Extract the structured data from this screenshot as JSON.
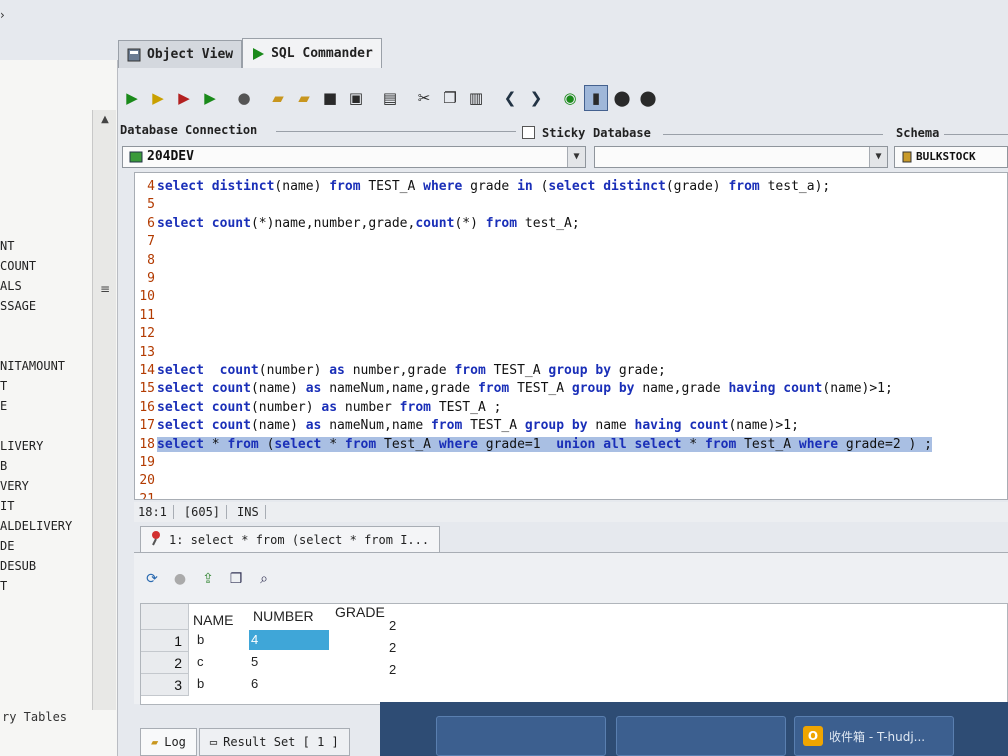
{
  "window": {
    "corner_glyph": "›"
  },
  "tabs": [
    {
      "label": "Object View",
      "active": false
    },
    {
      "label": "SQL Commander",
      "active": true
    }
  ],
  "connection": {
    "database_connection_label": "Database Connection",
    "database_connection_value": "204DEV",
    "sticky_label": "Sticky",
    "database_label": "Database",
    "database_value": "",
    "schema_label": "Schema",
    "schema_value": "BULKSTOCK"
  },
  "left_tree": {
    "items": [
      "NT",
      "COUNT",
      "ALS",
      "SSAGE",
      "",
      "",
      "NITAMOUNT",
      "T",
      "E",
      "",
      "LIVERY",
      "B",
      "VERY",
      "IT",
      "ALDELIVERY",
      "DE",
      "DESUB",
      "T"
    ],
    "bottom_label": "ry Tables"
  },
  "editor": {
    "lines": [
      {
        "n": "4",
        "text": "select distinct(name) from TEST_A where grade in (select distinct(grade) from test_a);",
        "highlight": false
      },
      {
        "n": "5",
        "text": "",
        "highlight": false
      },
      {
        "n": "6",
        "text": "select count(*)name,number,grade,count(*) from test_A;",
        "highlight": false
      },
      {
        "n": "7",
        "text": "",
        "highlight": false
      },
      {
        "n": "8",
        "text": "",
        "highlight": false
      },
      {
        "n": "9",
        "text": "",
        "highlight": false
      },
      {
        "n": "10",
        "text": "",
        "highlight": false
      },
      {
        "n": "11",
        "text": "",
        "highlight": false
      },
      {
        "n": "12",
        "text": "",
        "highlight": false
      },
      {
        "n": "13",
        "text": "",
        "highlight": false
      },
      {
        "n": "14",
        "text": "select  count(number) as number,grade from TEST_A group by grade;",
        "highlight": false
      },
      {
        "n": "15",
        "text": "select count(name) as nameNum,name,grade from TEST_A group by name,grade having count(name)>1;",
        "highlight": false
      },
      {
        "n": "16",
        "text": "select count(number) as number from TEST_A ;",
        "highlight": false
      },
      {
        "n": "17",
        "text": "select count(name) as nameNum,name from TEST_A group by name having count(name)>1;",
        "highlight": false
      },
      {
        "n": "18",
        "text": "select * from (select * from Test_A where grade=1  union all select * from Test_A where grade=2 ) ;",
        "highlight": true
      },
      {
        "n": "19",
        "text": "",
        "highlight": false
      },
      {
        "n": "20",
        "text": "",
        "highlight": false
      },
      {
        "n": "21",
        "text": "",
        "highlight": false
      }
    ]
  },
  "status": {
    "position": "18:1",
    "length": "[605]",
    "mode": "INS"
  },
  "result_tab": {
    "label": "1: select * from (select * from I..."
  },
  "grid": {
    "columns": [
      "NAME",
      "NUMBER",
      "GRADE"
    ],
    "rows": [
      {
        "idx": "1",
        "name": "b",
        "number": "4",
        "grade": "2"
      },
      {
        "idx": "2",
        "name": "c",
        "number": "5",
        "grade": "2"
      },
      {
        "idx": "3",
        "name": "b",
        "number": "6",
        "grade": "2"
      }
    ]
  },
  "bottom_tabs": [
    {
      "label": "Log"
    },
    {
      "label": "Result Set [ 1 ]"
    }
  ],
  "taskbar": {
    "item": "收件箱 - T-hudj..."
  }
}
